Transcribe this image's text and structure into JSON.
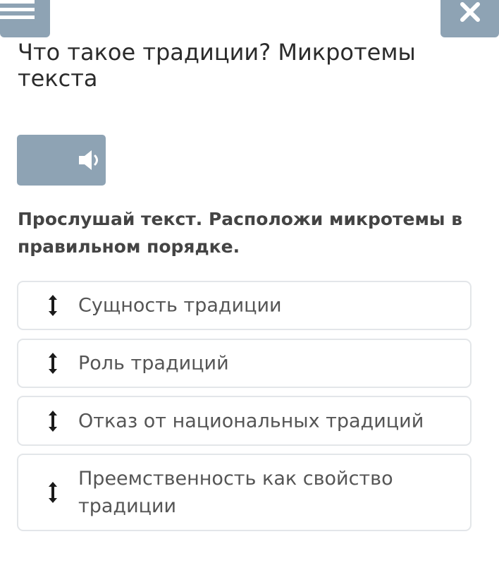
{
  "header": {
    "menu_icon": "hamburger-menu-icon",
    "close_icon": "close-x-icon"
  },
  "title": "Что такое традиции? Микротемы текста",
  "audio": {
    "icon": "speaker-icon"
  },
  "instruction": "Прослушай текст. Расположи микротемы в правильном порядке.",
  "items": [
    {
      "label": "Сущность традиции"
    },
    {
      "label": "Роль традиций"
    },
    {
      "label": "Отказ от национальных традиций"
    },
    {
      "label": "Преемственность как свойство традиции"
    }
  ],
  "colors": {
    "button_bg": "#8ea3b4",
    "item_border": "#e3e6e9",
    "title_text": "#2b2b2b",
    "instruction_text": "#444444",
    "item_text": "#555555"
  }
}
